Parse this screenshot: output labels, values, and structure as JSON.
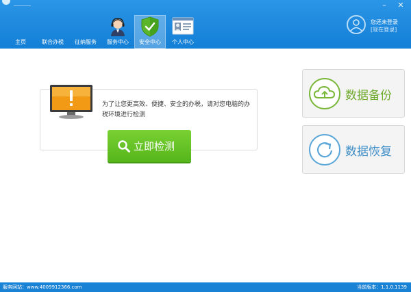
{
  "window": {
    "title": "_____"
  },
  "nav": {
    "items": [
      {
        "label": "主页"
      },
      {
        "label": "联合办税"
      },
      {
        "label": "征纳服务"
      },
      {
        "label": "服务中心"
      },
      {
        "label": "安全中心"
      },
      {
        "label": "个人中心"
      }
    ],
    "active_index": 4
  },
  "user": {
    "status": "您还未登录",
    "login_link": "[现在登录]"
  },
  "check": {
    "description": "为了让您更高效、便捷、安全的办税，请对您电脑的办税环境进行检测",
    "button_label": "立即检测"
  },
  "side": {
    "backup_label": "数据备份",
    "restore_label": "数据恢复"
  },
  "status": {
    "website": "服务网站：www.4009912366.com",
    "version": "当前版本：1.1.0.1139"
  },
  "colors": {
    "header_blue": "#1a82d5",
    "button_green": "#5cb91f",
    "backup_green": "#71ab2f",
    "restore_blue": "#3f8fc8",
    "monitor_orange": "#f29a16"
  }
}
